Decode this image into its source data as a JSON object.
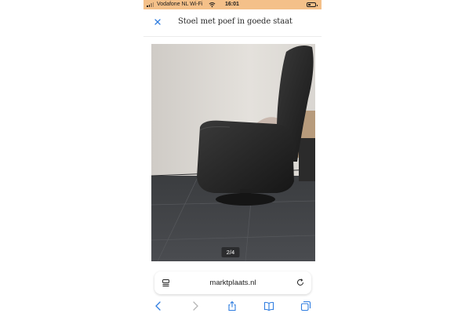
{
  "status_bar": {
    "carrier": "Vodafone NL Wi-Fi",
    "time": "16:01",
    "background": "#f4c089"
  },
  "header": {
    "title": "Stoel met poef in goede staat",
    "close_icon": "close-icon"
  },
  "gallery": {
    "counter": "2/4"
  },
  "browser": {
    "url": "marktplaats.nl",
    "icons": [
      "reader-icon",
      "reload-icon",
      "back-icon",
      "forward-icon",
      "share-icon",
      "bookmarks-icon",
      "tabs-icon"
    ],
    "accent": "#2f7de0"
  }
}
